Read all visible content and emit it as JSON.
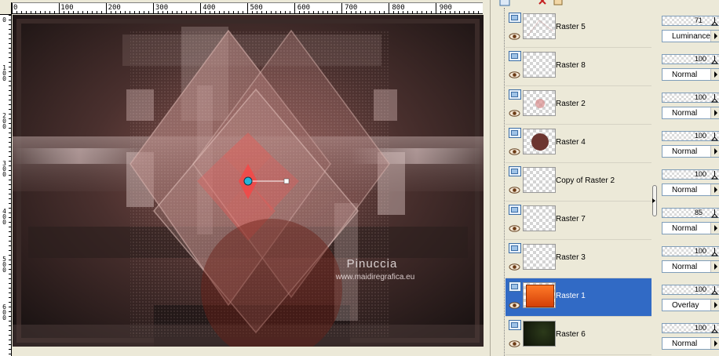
{
  "ruler": {
    "h_labels": [
      "0",
      "100",
      "200",
      "300",
      "400",
      "500",
      "600",
      "700",
      "800",
      "900"
    ],
    "v_labels": [
      "0",
      "1\n0\n0",
      "2\n0\n0",
      "3\n0\n0",
      "4\n0\n0",
      "5\n0\n0",
      "6\n0\n0"
    ]
  },
  "canvas": {
    "watermark_title": "Pinuccia",
    "watermark_url": "www.maidiregrafica.eu"
  },
  "layers": [
    {
      "name": "Raster 5",
      "opacity": "71",
      "blend": "Luminance",
      "thumb": "transparent-pattern",
      "selected": false
    },
    {
      "name": "Raster 8",
      "opacity": "100",
      "blend": "Normal",
      "thumb": "transparent",
      "selected": false
    },
    {
      "name": "Raster 2",
      "opacity": "100",
      "blend": "Normal",
      "thumb": "pink-dot",
      "selected": false
    },
    {
      "name": "Raster 4",
      "opacity": "100",
      "blend": "Normal",
      "thumb": "brown-circle",
      "selected": false
    },
    {
      "name": "Copy of Raster 2",
      "opacity": "100",
      "blend": "Normal",
      "thumb": "transparent",
      "selected": false
    },
    {
      "name": "Raster 7",
      "opacity": "85",
      "blend": "Normal",
      "thumb": "transparent",
      "selected": false
    },
    {
      "name": "Raster 3",
      "opacity": "100",
      "blend": "Normal",
      "thumb": "transparent",
      "selected": false
    },
    {
      "name": "Raster 1",
      "opacity": "100",
      "blend": "Overlay",
      "thumb": "orange-fill",
      "selected": true
    },
    {
      "name": "Raster 6",
      "opacity": "100",
      "blend": "Normal",
      "thumb": "dark-green",
      "selected": false
    }
  ],
  "colors": {
    "selection": "#316ac5",
    "panel_bg": "#ece9d8",
    "accent_orange": "#e8551a",
    "brown": "#6b3530"
  },
  "icons": [
    "raster-layer-icon",
    "visibility-eye-icon",
    "delete-layer-icon",
    "expand-arrow-icon"
  ]
}
